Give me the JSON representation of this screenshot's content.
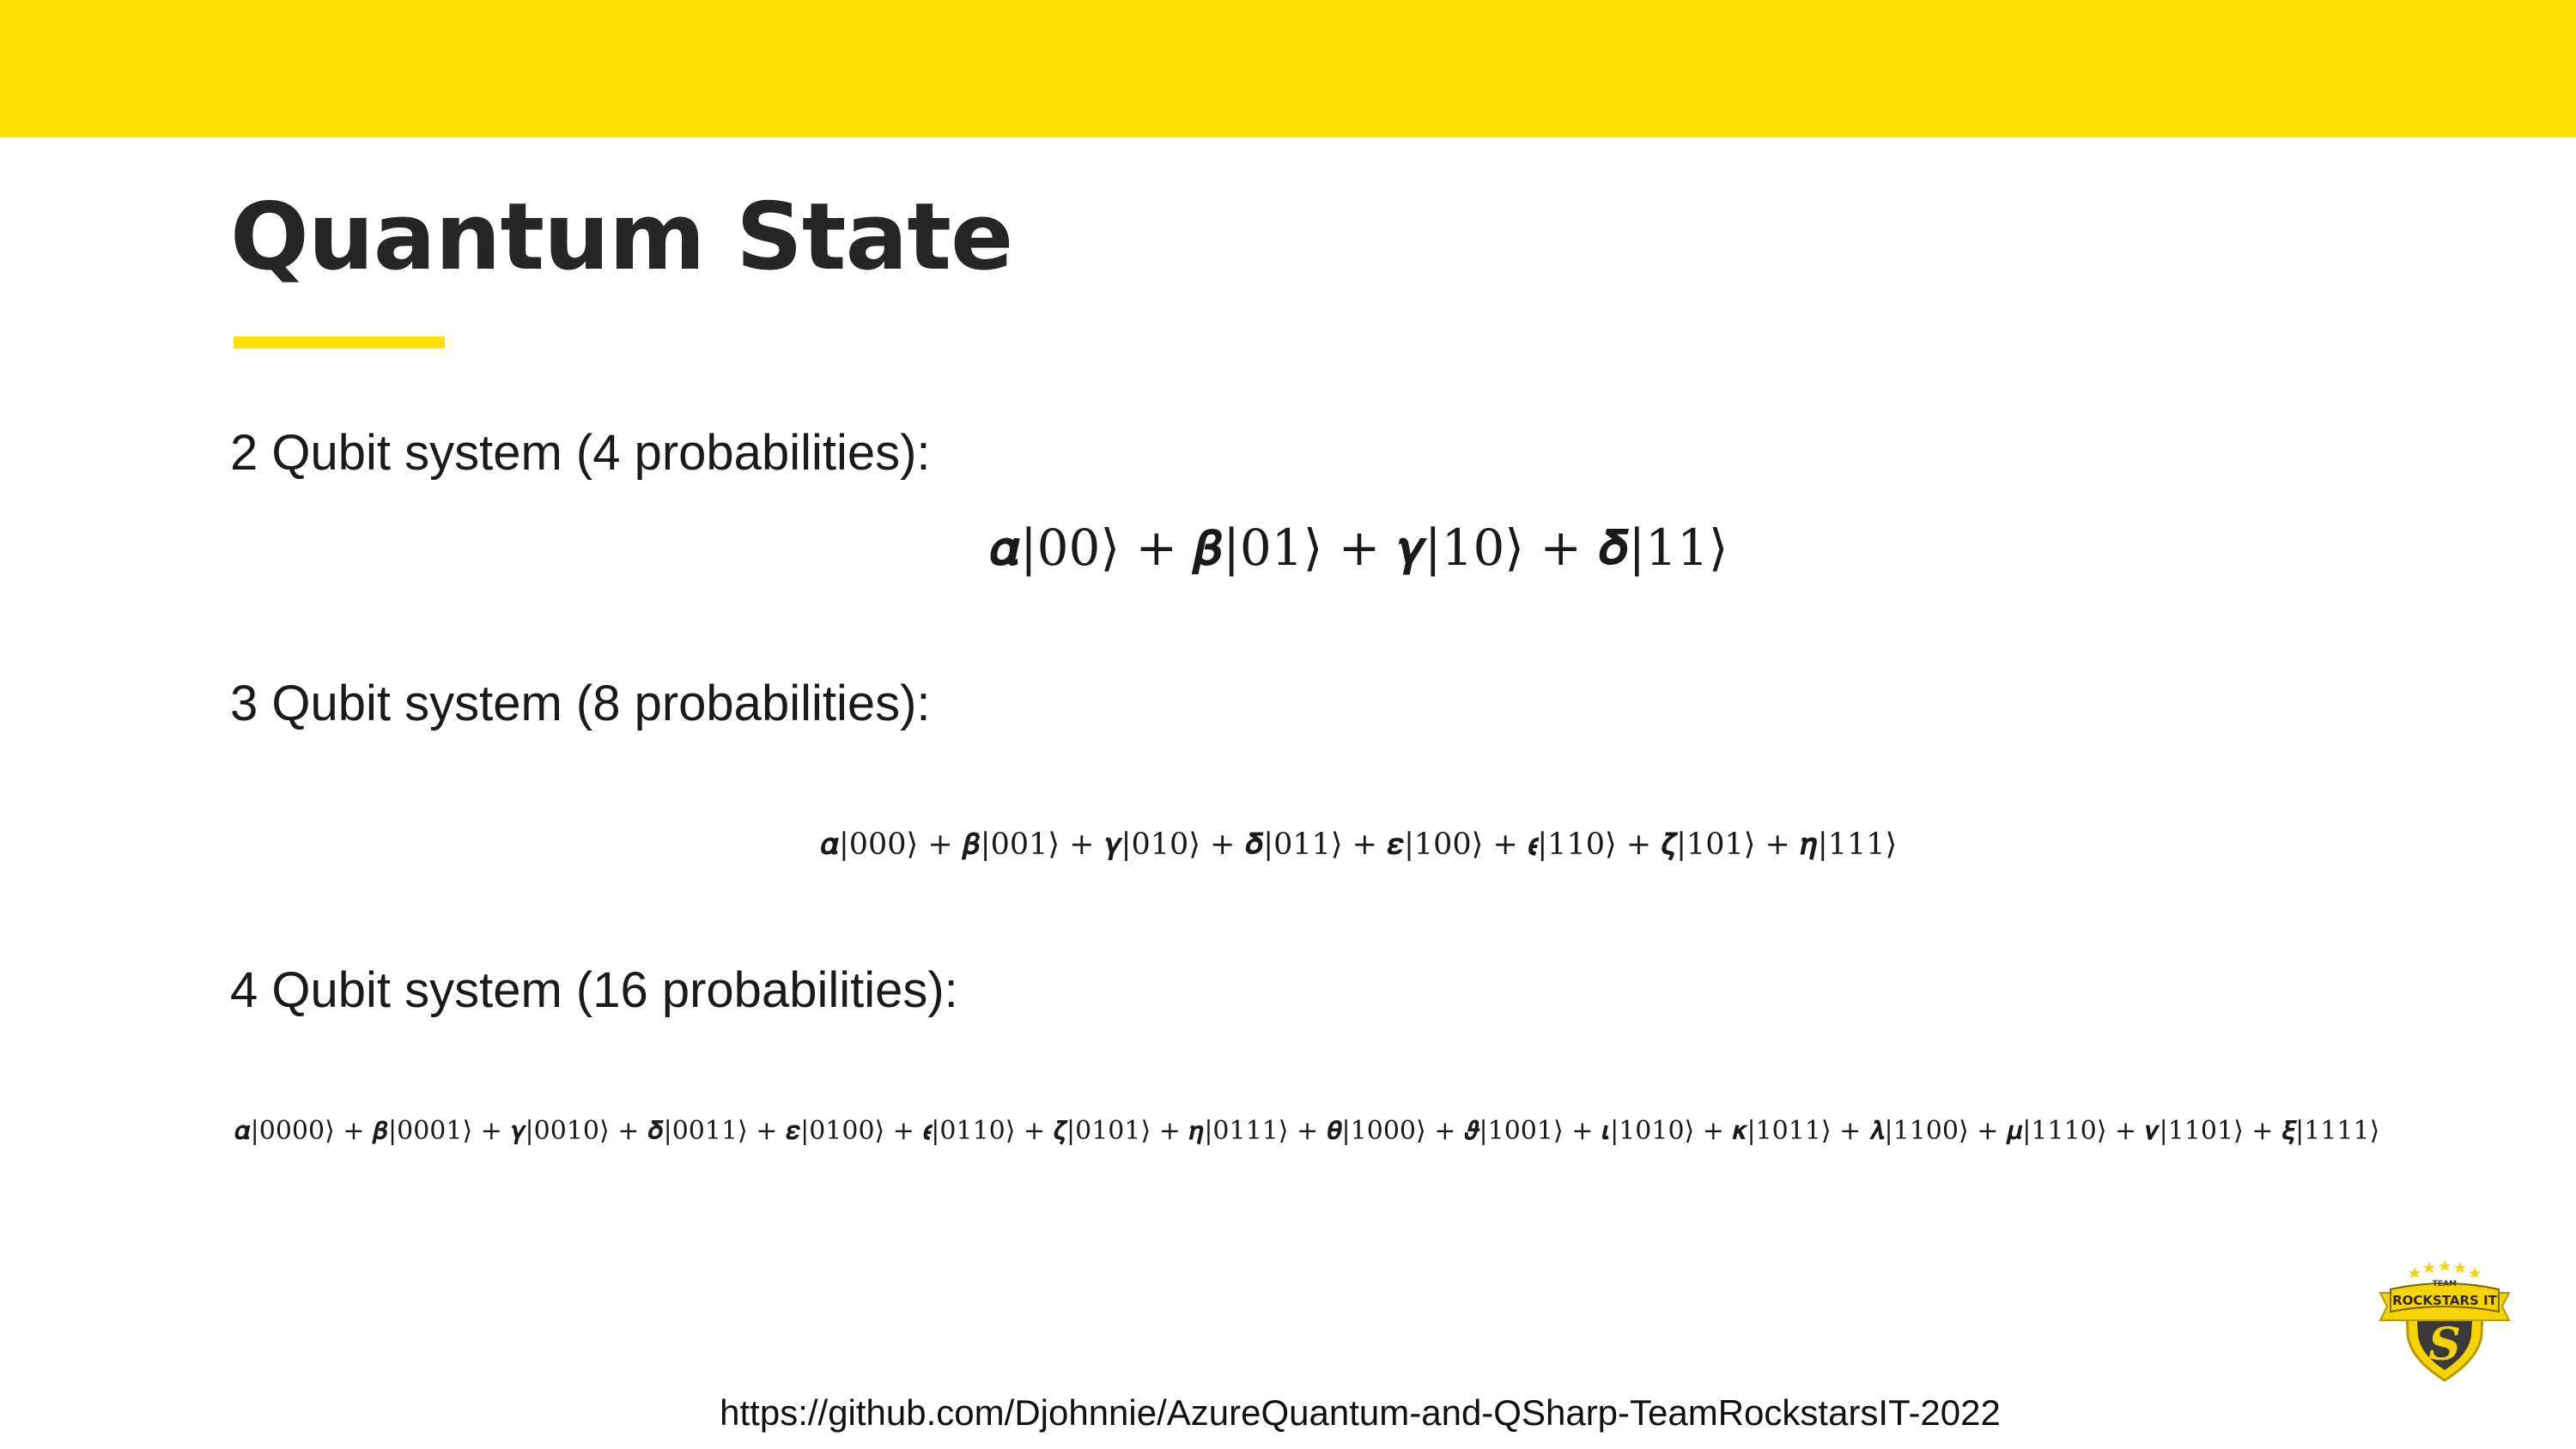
{
  "slide": {
    "title": "Quantum State",
    "sections": [
      {
        "heading": "2 Qubit system (4 probabilities):",
        "formula": "𝜶|00⟩ + 𝜷|01⟩ + 𝜸|10⟩ + 𝜹|11⟩"
      },
      {
        "heading": "3 Qubit system (8 probabilities):",
        "formula": "𝜶|000⟩ + 𝜷|001⟩ + 𝜸|010⟩ + 𝜹|011⟩ + 𝜺|100⟩ + 𝝐|110⟩ + 𝜻|101⟩ + 𝜼|111⟩"
      },
      {
        "heading": "4 Qubit system (16 probabilities):",
        "formula": "𝜶|0000⟩ + 𝜷|0001⟩ + 𝜸|0010⟩ + 𝜹|0011⟩ + 𝜺|0100⟩ + 𝝐|0110⟩ + 𝜻|0101⟩ + 𝜼|0111⟩ + 𝜽|1000⟩ + 𝝑|1001⟩ + 𝜾|1010⟩ + 𝜿|1011⟩ + 𝝀|1100⟩ + 𝝁|1110⟩ + 𝝂|1101⟩ + 𝝃|1111⟩"
      }
    ],
    "footer_url": "https://github.com/Djohnnie/AzureQuantum-and-QSharp-TeamRockstarsIT-2022"
  },
  "logo": {
    "top_text": "TEAM",
    "main_text": "ROCKSTARS IT",
    "letter": "S",
    "icon": "team-rockstars-shield-logo"
  },
  "colors": {
    "accent": "#FFE000",
    "text": "#262626",
    "logo_dark": "#3a3a3a",
    "logo_gold": "#F5D400"
  }
}
